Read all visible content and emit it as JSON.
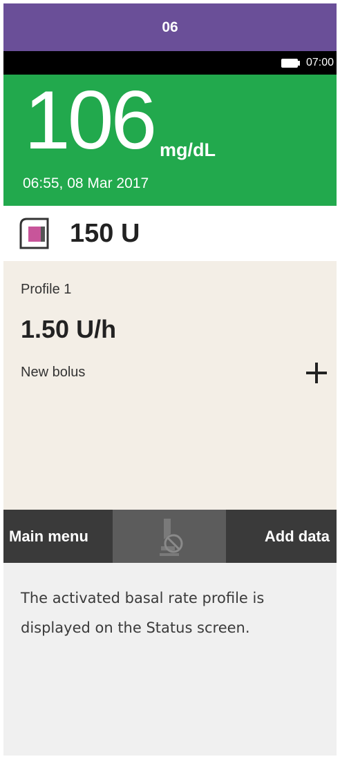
{
  "step_number": "06",
  "status_bar": {
    "time": "07:00",
    "battery_icon": "battery-icon"
  },
  "glucose": {
    "value": "106",
    "unit": "mg/dL",
    "timestamp": "06:55, 08 Mar 2017"
  },
  "reservoir": {
    "amount": "150 U",
    "icon": "cartridge-icon"
  },
  "basal": {
    "profile": "Profile 1",
    "rate": "1.50 U/h"
  },
  "bolus": {
    "label": "New bolus",
    "icon": "plus-icon"
  },
  "softkeys": {
    "left": "Main menu",
    "center_icon": "pump-stop-icon",
    "right": "Add data"
  },
  "caption": "The activated basal rate profile is displayed on the Status screen.",
  "colors": {
    "header": "#6a4f98",
    "glucose_panel": "#22a94d",
    "content_bg": "#f3eee6",
    "softkey_bar": "#3a3a3a",
    "cartridge_accent": "#c8559a"
  }
}
